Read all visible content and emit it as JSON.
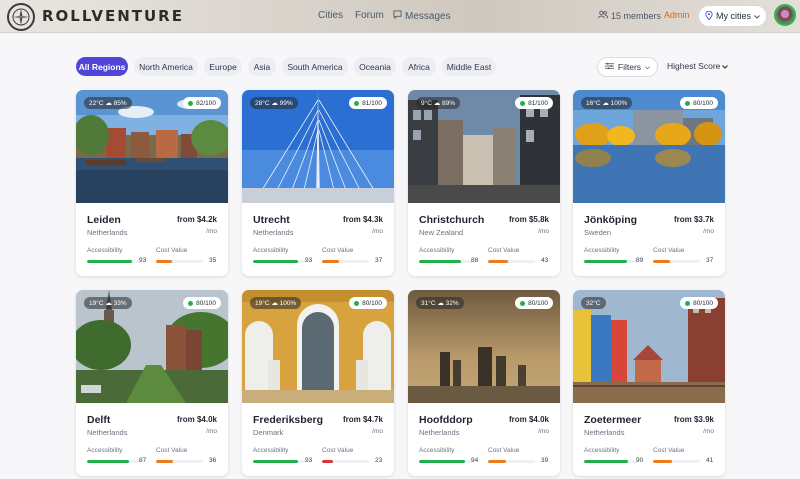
{
  "brand": "ROLLVENTURE",
  "nav": {
    "cities": "Cities",
    "forum": "Forum",
    "messages": "Messages"
  },
  "header": {
    "members": "15 members",
    "admin": "Admin",
    "my_cities": "My cities"
  },
  "regions": [
    "All Regions",
    "North America",
    "Europe",
    "Asia",
    "South America",
    "Oceania",
    "Africa",
    "Middle East"
  ],
  "filters_label": "Filters",
  "sort_label": "Highest Score",
  "metric_labels": {
    "accessibility": "Accessibility",
    "cost": "Cost Value"
  },
  "per_month": "/mo",
  "colors": {
    "accent": "#4f46d8",
    "accessibility_bar": "#22b04b",
    "cost_bar": "#f07a1a",
    "cost_bar_low": "#e0323c",
    "admin": "#e2650a"
  },
  "cards": [
    {
      "weather": "22°C ☁ 85%",
      "score": "82/100",
      "city": "Leiden",
      "country": "Netherlands",
      "price": "from $4.2k",
      "accessibility": "93",
      "cost": "35"
    },
    {
      "weather": "28°C ☁ 99%",
      "score": "81/100",
      "city": "Utrecht",
      "country": "Netherlands",
      "price": "from $4.3k",
      "accessibility": "93",
      "cost": "37"
    },
    {
      "weather": "9°C ☁ 89%",
      "score": "81/100",
      "city": "Christchurch",
      "country": "New Zealand",
      "price": "from $5.8k",
      "accessibility": "88",
      "cost": "43"
    },
    {
      "weather": "16°C ☁ 100%",
      "score": "80/100",
      "city": "Jönköping",
      "country": "Sweden",
      "price": "from $3.7k",
      "accessibility": "89",
      "cost": "37"
    },
    {
      "weather": "19°C ☁ 33%",
      "score": "80/100",
      "city": "Delft",
      "country": "Netherlands",
      "price": "from $4.0k",
      "accessibility": "87",
      "cost": "36"
    },
    {
      "weather": "19°C ☁ 100%",
      "score": "80/100",
      "city": "Frederiksberg",
      "country": "Denmark",
      "price": "from $4.7k",
      "accessibility": "93",
      "cost": "23"
    },
    {
      "weather": "31°C ☁ 32%",
      "score": "80/100",
      "city": "Hoofddorp",
      "country": "Netherlands",
      "price": "from $4.0k",
      "accessibility": "94",
      "cost": "39"
    },
    {
      "weather": "32°C",
      "score": "80/100",
      "city": "Zoetermeer",
      "country": "Netherlands",
      "price": "from $3.9k",
      "accessibility": "90",
      "cost": "41"
    }
  ]
}
